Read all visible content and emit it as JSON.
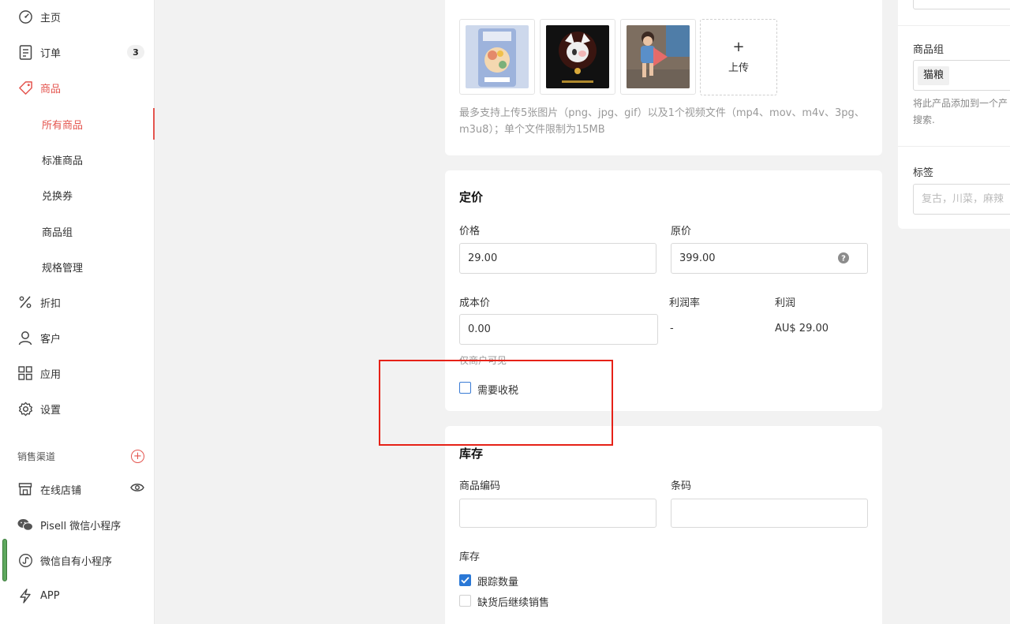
{
  "sidebar": {
    "items": [
      {
        "label": "主页",
        "icon": "dashboard-icon"
      },
      {
        "label": "订单",
        "icon": "orders-icon",
        "badge": "3"
      },
      {
        "label": "商品",
        "icon": "tag-icon"
      },
      {
        "label": "折扣",
        "icon": "percent-icon"
      },
      {
        "label": "客户",
        "icon": "user-icon"
      },
      {
        "label": "应用",
        "icon": "apps-icon"
      },
      {
        "label": "设置",
        "icon": "gear-icon"
      }
    ],
    "sub_items": [
      "所有商品",
      "标准商品",
      "兑换券",
      "商品组",
      "规格管理"
    ],
    "channels_label": "销售渠道",
    "channels": [
      {
        "label": "在线店铺",
        "icon": "store-icon"
      },
      {
        "label": "Pisell 微信小程序",
        "icon": "wechat-icon"
      },
      {
        "label": "微信自有小程序",
        "icon": "mini-program-icon"
      },
      {
        "label": "APP",
        "icon": "lightning-icon"
      }
    ]
  },
  "media": {
    "upload_label": "上传",
    "hint_line1": "最多支持上传5张图片（png、jpg、gif）以及1个视频文件（mp4、mov、m4v、3pg、",
    "hint_line2": "m3u8）；单个文件限制为15MB"
  },
  "pricing": {
    "title": "定价",
    "price_label": "价格",
    "price_value": "29.00",
    "original_label": "原价",
    "original_value": "399.00",
    "cost_label": "成本价",
    "cost_value": "0.00",
    "margin_label": "利润率",
    "margin_value": "-",
    "profit_label": "利润",
    "profit_value": "AU$ 29.00",
    "visibility_note": "仅商户可见",
    "tax_label": "需要收税"
  },
  "inventory": {
    "title": "库存",
    "sku_label": "商品编码",
    "barcode_label": "条码",
    "stock_label": "库存",
    "track_label": "跟踪数量",
    "continue_label": "缺货后继续销售"
  },
  "right_panel": {
    "group_label": "商品组",
    "group_tag": "猫粮",
    "group_hint_line1": "将此产品添加到一个产",
    "group_hint_line2": "搜索.",
    "tags_label": "标签",
    "tags_placeholder": "复古，川菜，麻辣"
  },
  "colors": {
    "accent": "#e4554f",
    "checkbox_blue": "#2a78d6",
    "highlight_box": "#e62117"
  }
}
